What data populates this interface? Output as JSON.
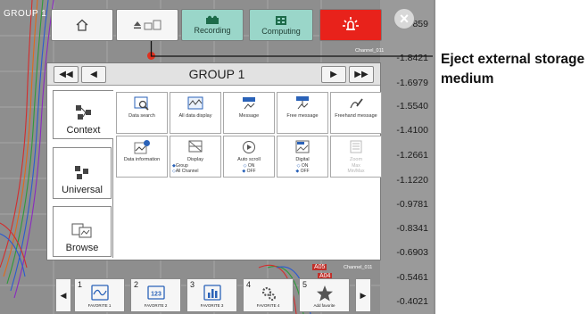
{
  "screen": {
    "group_tag": "GROUP 1",
    "scale_labels": [
      "-1.9859",
      "-1.8421",
      "-1.6979",
      "-1.5540",
      "-1.4100",
      "-1.2661",
      "-1.1220",
      "-0.9781",
      "-0.8341",
      "-0.6903",
      "-0.5461",
      "-0.4021"
    ],
    "channel_tags": [
      "Channel_011",
      "Channel_011"
    ],
    "alarm_tags": [
      "A05",
      "A04"
    ]
  },
  "toolbar": {
    "recording_label": "Recording",
    "computing_label": "Computing"
  },
  "panel": {
    "title": "GROUP 1",
    "tabs": [
      {
        "label": "Context"
      },
      {
        "label": "Universal"
      },
      {
        "label": "Browse"
      }
    ],
    "tiles": [
      {
        "label": "Data search"
      },
      {
        "label": "All data display"
      },
      {
        "label": "Message"
      },
      {
        "label": "Free message"
      },
      {
        "label": "Freehand message"
      },
      {
        "label": "Data information"
      },
      {
        "label": "Display",
        "sub1": "Group",
        "sub2": "All Channel"
      },
      {
        "label": "Auto scroll",
        "sub1": "ON",
        "sub2": "OFF"
      },
      {
        "label": "Digital",
        "sub1": "ON",
        "sub2": "OFF"
      },
      {
        "label": "Zoom",
        "sub1": "Max",
        "sub2": "Min/Max"
      }
    ]
  },
  "favorites": [
    {
      "num": "1",
      "label": "FAVORITE 1"
    },
    {
      "num": "2",
      "label": "FAVORITE 2"
    },
    {
      "num": "3",
      "label": "FAVORITE 3"
    },
    {
      "num": "4",
      "label": "FAVORITE 4"
    },
    {
      "num": "5",
      "label": "Add favorite"
    }
  ],
  "callout": {
    "text": "Eject external storage medium"
  },
  "colors": {
    "accent_red": "#e8221b",
    "teal": "#9ad6c9",
    "callout_dot": "#e0301e"
  }
}
